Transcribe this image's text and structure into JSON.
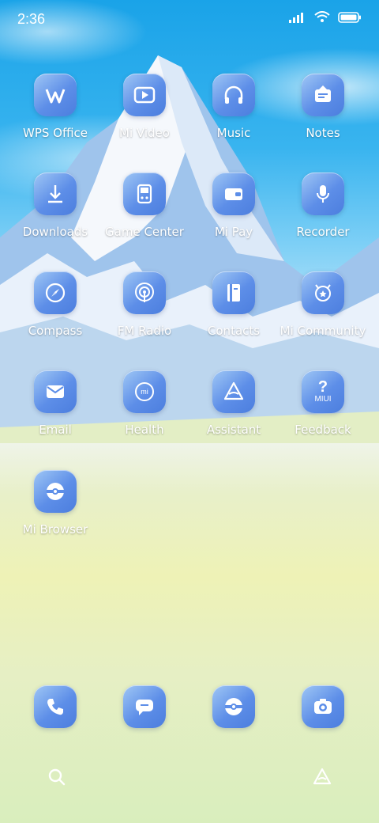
{
  "status_bar": {
    "time": "2:36",
    "icons": [
      "signal-icon",
      "wifi-icon",
      "battery-icon"
    ]
  },
  "apps": [
    {
      "label": "WPS Office",
      "icon": "wps-icon"
    },
    {
      "label": "Mi Video",
      "icon": "video-icon"
    },
    {
      "label": "Music",
      "icon": "headphones-icon"
    },
    {
      "label": "Notes",
      "icon": "notes-icon"
    },
    {
      "label": "Downloads",
      "icon": "download-icon"
    },
    {
      "label": "Game Center",
      "icon": "gamepad-icon"
    },
    {
      "label": "Mi Pay",
      "icon": "wallet-icon"
    },
    {
      "label": "Recorder",
      "icon": "microphone-icon"
    },
    {
      "label": "Compass",
      "icon": "compass-icon"
    },
    {
      "label": "FM Radio",
      "icon": "radio-icon"
    },
    {
      "label": "Contacts",
      "icon": "contacts-book-icon"
    },
    {
      "label": "Mi Community",
      "icon": "community-icon"
    },
    {
      "label": "Email",
      "icon": "email-icon"
    },
    {
      "label": "Health",
      "icon": "health-icon"
    },
    {
      "label": "Assistant",
      "icon": "assistant-icon"
    },
    {
      "label": "Feedback",
      "icon": "feedback-icon"
    },
    {
      "label": "Mi Browser",
      "icon": "browser-icon"
    }
  ],
  "dock": [
    {
      "label": "Phone",
      "icon": "phone-icon"
    },
    {
      "label": "Messaging",
      "icon": "message-icon"
    },
    {
      "label": "Browser",
      "icon": "browser-icon"
    },
    {
      "label": "Camera",
      "icon": "camera-icon"
    }
  ],
  "bottom_bar": {
    "left_icon": "search-icon",
    "right_icon": "assistant-icon"
  },
  "brand_text": {
    "feedback_badge": "MIUI",
    "health_badge": "mi"
  }
}
